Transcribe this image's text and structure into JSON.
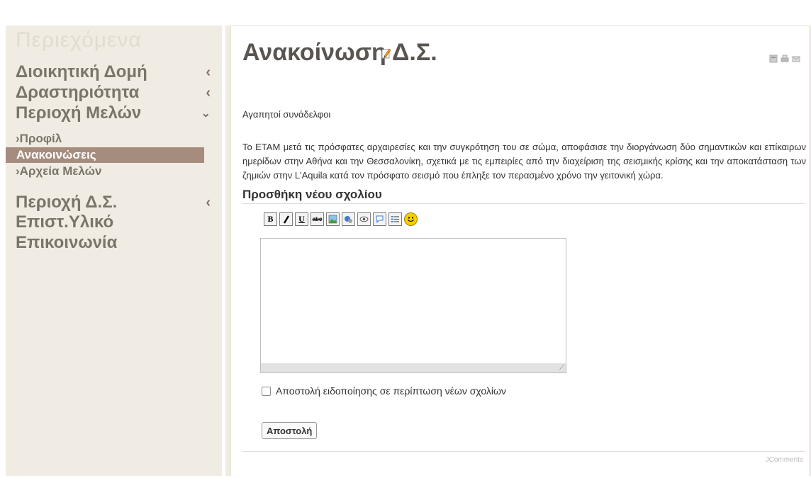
{
  "sidebar": {
    "title": "Περιεχόμενα",
    "items": [
      {
        "label": "Διοικητική Δομή",
        "chevron": "‹"
      },
      {
        "label": "Δραστηριότητα",
        "chevron": "‹"
      },
      {
        "label": "Περιοχή Μελών",
        "chevron": "⌄"
      }
    ],
    "subitems": [
      {
        "label": "›Προφίλ"
      },
      {
        "label": "Ανακοινώσεις"
      },
      {
        "label": "›Αρχεία Μελών"
      }
    ],
    "lower_items": [
      {
        "label": "Περιοχή Δ.Σ.",
        "chevron": "‹"
      },
      {
        "label": "Επιστ.Υλικό"
      },
      {
        "label": "Επικοινωνία"
      }
    ]
  },
  "article": {
    "title": "Ανακοίνωση Δ.Σ.",
    "greeting": "Αγαπητοί συνάδελφοι",
    "body": "Το ΕΤΑΜ μετά τις πρόσφατες αρχαιρεσίες και την συγκρότηση του σε σώμα, αποφάσισε την διοργάνωση δύο σημαντικών και επίκαιρων ημερίδων στην Αθήνα και την Θεσσαλονίκη, σχετικά με τις εμπειρίες από την διαχείριση της σεισμικής κρίσης και την αποκατάσταση των ζημιών στην L'Aquila κατά τον πρόσφατο σεισμό που έπληξε τον περασμένο χρόνο την γειτονική χώρα."
  },
  "comments": {
    "heading": "Προσθήκη νέου σχολίου",
    "toolbar": [
      "B",
      "I",
      "U",
      "abc",
      "image",
      "link",
      "hide",
      "quote",
      "list",
      "smile"
    ],
    "notify_label": "Αποστολή ειδοποίησης σε περίπτωση νέων σχολίων",
    "submit_label": "Αποστολή",
    "footer": "JComments"
  },
  "colors": {
    "sidebar_bg": "#f1ece3",
    "active_item": "#a58c7e",
    "nav_text": "#7a746b"
  }
}
